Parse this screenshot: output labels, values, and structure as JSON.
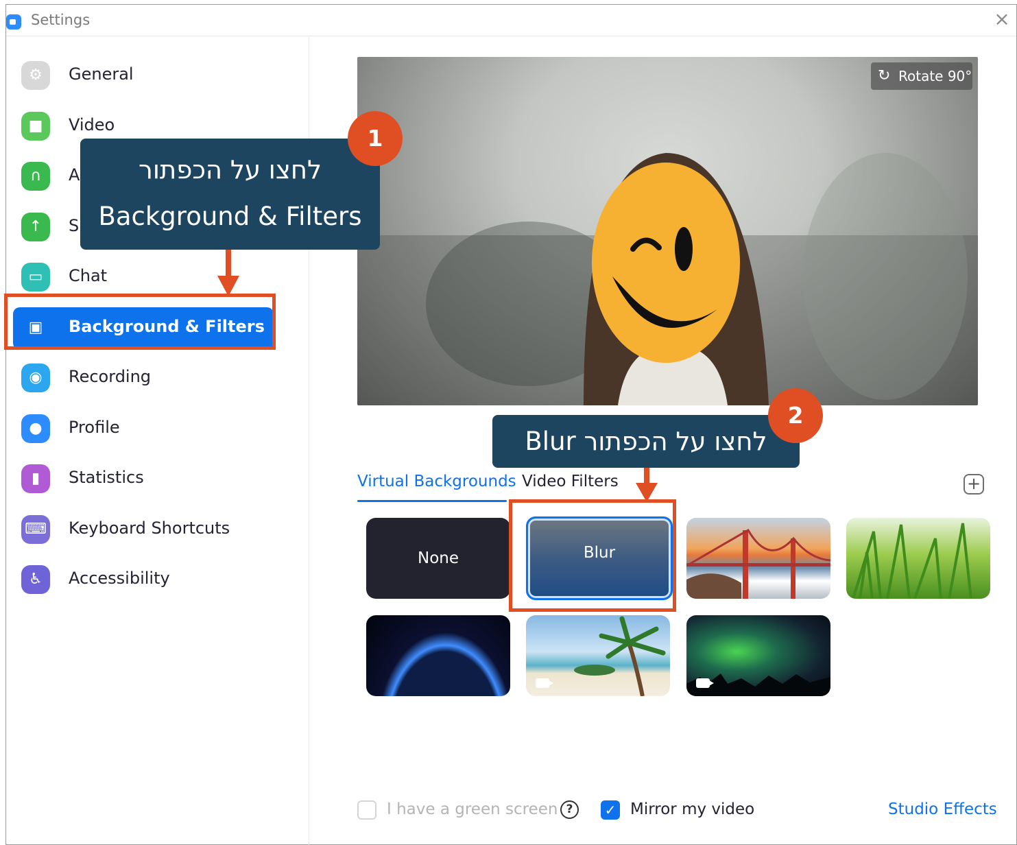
{
  "window": {
    "title": "Settings",
    "close_glyph": "×"
  },
  "sidebar": {
    "items": [
      {
        "label": "General",
        "icon": "gear-icon",
        "color": "#d8d8d8",
        "glyph": "⚙"
      },
      {
        "label": "Video",
        "icon": "video-camera-icon",
        "color": "#5ac85a",
        "glyph": "■"
      },
      {
        "label": "Audio",
        "icon": "headphones-icon",
        "color": "#3ab94f",
        "glyph": "∩"
      },
      {
        "label": "Share Screen",
        "icon": "share-screen-icon",
        "color": "#3ab94f",
        "glyph": "↑"
      },
      {
        "label": "Chat",
        "icon": "chat-bubble-icon",
        "color": "#2fc0b5",
        "glyph": "▭"
      },
      {
        "label": "Background & Filters",
        "icon": "background-person-icon",
        "color": "#0e72ed",
        "glyph": "▣"
      },
      {
        "label": "Recording",
        "icon": "record-icon",
        "color": "#2da6f0",
        "glyph": "◉"
      },
      {
        "label": "Profile",
        "icon": "user-profile-icon",
        "color": "#2d8cff",
        "glyph": "●"
      },
      {
        "label": "Statistics",
        "icon": "bar-chart-icon",
        "color": "#b05ad6",
        "glyph": "▮"
      },
      {
        "label": "Keyboard Shortcuts",
        "icon": "keyboard-icon",
        "color": "#7b6ed9",
        "glyph": "⌨"
      },
      {
        "label": "Accessibility",
        "icon": "accessibility-icon",
        "color": "#6e64d8",
        "glyph": "♿"
      }
    ]
  },
  "preview": {
    "rotate_label": "Rotate 90°",
    "rotate_glyph": "↻"
  },
  "tabs": {
    "virtual_backgrounds": "Virtual Backgrounds",
    "video_filters": "Video Filters",
    "add_glyph": "+"
  },
  "backgrounds": {
    "none_label": "None",
    "blur_label": "Blur"
  },
  "footer": {
    "green_screen_label": "I have a green screen",
    "help_glyph": "?",
    "mirror_label": "Mirror my video",
    "mirror_checked": true,
    "check_glyph": "✓",
    "studio_effects_label": "Studio Effects"
  },
  "annotations": {
    "step1_number": "1",
    "step1_line1": "לחצו על הכפתור",
    "step1_line2": "Background & Filters",
    "step2_number": "2",
    "step2_text": "לחצו על הכפתור Blur"
  },
  "colors": {
    "accent": "#0e72ed",
    "annotation_orange": "#e04e23",
    "callout_bg": "#1e4560"
  }
}
